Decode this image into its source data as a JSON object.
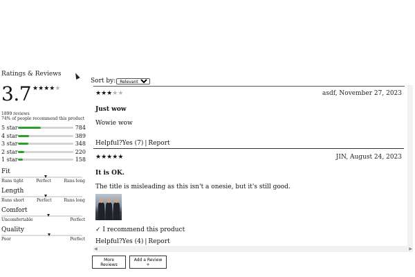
{
  "summary": {
    "title": "Ratings & Reviews",
    "average": "3.7",
    "average_value": 3.7,
    "stars_filled": 4,
    "stars_total": 5,
    "review_count": "1899 reviews",
    "recommend_text": "74% of people recommend this product",
    "breakdown": [
      {
        "label": "5 star",
        "count": "784",
        "fraction": 0.413
      },
      {
        "label": "4 star",
        "count": "389",
        "fraction": 0.205
      },
      {
        "label": "3 star",
        "count": "348",
        "fraction": 0.183
      },
      {
        "label": "2 star",
        "count": "220",
        "fraction": 0.116
      },
      {
        "label": "1 star",
        "count": "158",
        "fraction": 0.083
      }
    ],
    "characteristics": [
      {
        "name": "Fit",
        "left": "Runs tight",
        "middle": "Perfect",
        "right": "Runs long",
        "level": 0.55
      },
      {
        "name": "Length",
        "left": "Runs short",
        "middle": "Perfect",
        "right": "Runs long",
        "level": 0.55
      },
      {
        "name": "Comfort",
        "left": "Uncomfortable",
        "middle": "",
        "right": "Perfect",
        "level": 0.58
      },
      {
        "name": "Quality",
        "left": "Poor",
        "middle": "",
        "right": "Perfect",
        "level": 0.59
      }
    ]
  },
  "sort": {
    "label": "Sort by:",
    "selected": "Relevant",
    "options": [
      "Relevant"
    ]
  },
  "reviews": [
    {
      "rating": 3,
      "meta": "asdf, November 27, 2023",
      "title": "Just wow",
      "body": "Wowie wow",
      "has_photo": false,
      "recommend": "",
      "helpful_label": "Helpful?",
      "yes_label": "Yes (7)",
      "report_label": "Report"
    },
    {
      "rating": 5,
      "meta": "JIN, August 24, 2023",
      "title": "It is OK.",
      "body": "The title is misleading as this isn't a onesie, but it's still good.",
      "has_photo": true,
      "recommend": "✓ I recommend this product",
      "helpful_label": "Helpful?",
      "yes_label": "Yes (4)",
      "report_label": "Report"
    }
  ],
  "buttons": {
    "more_reviews": "More Reviews",
    "add_review": "Add a Review +"
  },
  "colors": {
    "bar_fill": "#2aa12a",
    "bar_track": "#d4d4d4",
    "star_on": "#111111",
    "star_off": "#b5b5b5"
  }
}
